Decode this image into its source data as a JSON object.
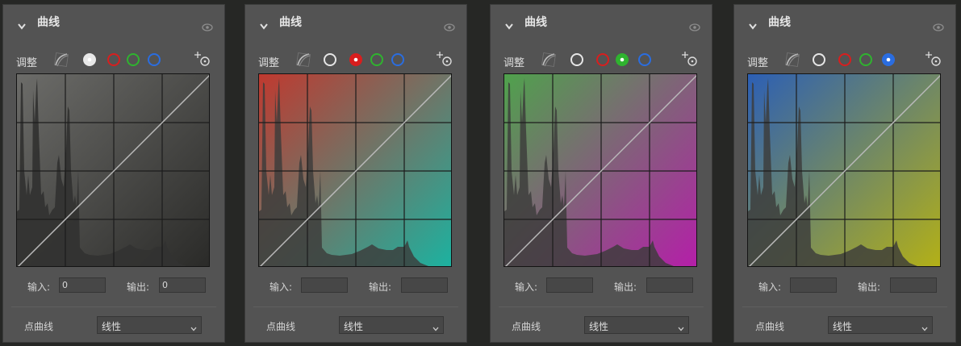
{
  "colors": {
    "panel_bg": "#535353",
    "rgb_active": "#e8e8e8",
    "red": "#d81e1e",
    "green": "#2fb32f",
    "blue": "#2a6de0"
  },
  "panels": [
    {
      "title": "曲线",
      "adjust_label": "调整",
      "active_channel": "rgb",
      "input_label": "输入:",
      "input_value": "0",
      "output_label": "输出:",
      "output_value": "0",
      "point_curve_label": "点曲线",
      "curve_mode": "线性",
      "icons": [
        "chevron-down-icon",
        "eye-icon",
        "auto-adjust-icon",
        "rgb-channel-icon",
        "red-channel-icon",
        "green-channel-icon",
        "blue-channel-icon",
        "targeted-adjustment-icon"
      ]
    },
    {
      "title": "曲线",
      "adjust_label": "调整",
      "active_channel": "red",
      "input_label": "输入:",
      "input_value": "",
      "output_label": "输出:",
      "output_value": "",
      "point_curve_label": "点曲线",
      "curve_mode": "线性"
    },
    {
      "title": "曲线",
      "adjust_label": "调整",
      "active_channel": "green",
      "input_label": "输入:",
      "input_value": "",
      "output_label": "输出:",
      "output_value": "",
      "point_curve_label": "点曲线",
      "curve_mode": "线性"
    },
    {
      "title": "曲线",
      "adjust_label": "调整",
      "active_channel": "blue",
      "input_label": "输入:",
      "input_value": "",
      "output_label": "输出:",
      "output_value": "",
      "point_curve_label": "点曲线",
      "curve_mode": "线性"
    }
  ]
}
